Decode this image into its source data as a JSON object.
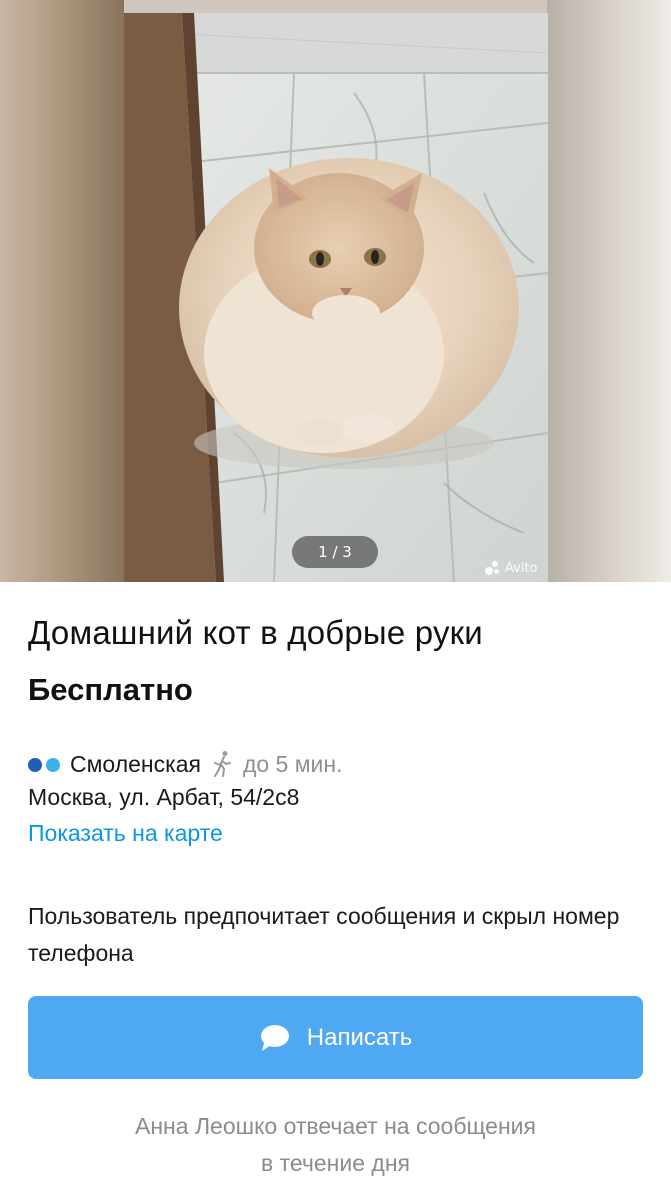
{
  "gallery": {
    "counter": "1 / 3",
    "watermark": "Avito"
  },
  "listing": {
    "title": "Домашний кот в добрые руки",
    "price": "Бесплатно"
  },
  "location": {
    "metro_station": "Смоленская",
    "metro_line_colors": [
      "#1f5fb8",
      "#3bb1ea"
    ],
    "walk_time": "до 5 мин.",
    "address": "Москва, ул. Арбат, 54/2с8",
    "map_link": "Показать на карте"
  },
  "contact": {
    "preference_text": "Пользователь предпочитает сообщения и скрыл номер телефона",
    "write_button": "Написать",
    "reply_note_line1": "Анна Леошко отвечает на сообщения",
    "reply_note_line2": "в течение дня"
  },
  "colors": {
    "accent_link": "#0a97e8",
    "button": "#4ea8f2"
  },
  "icons": [
    "walk-icon",
    "chat-bubble-icon",
    "avito-logo-icon"
  ]
}
